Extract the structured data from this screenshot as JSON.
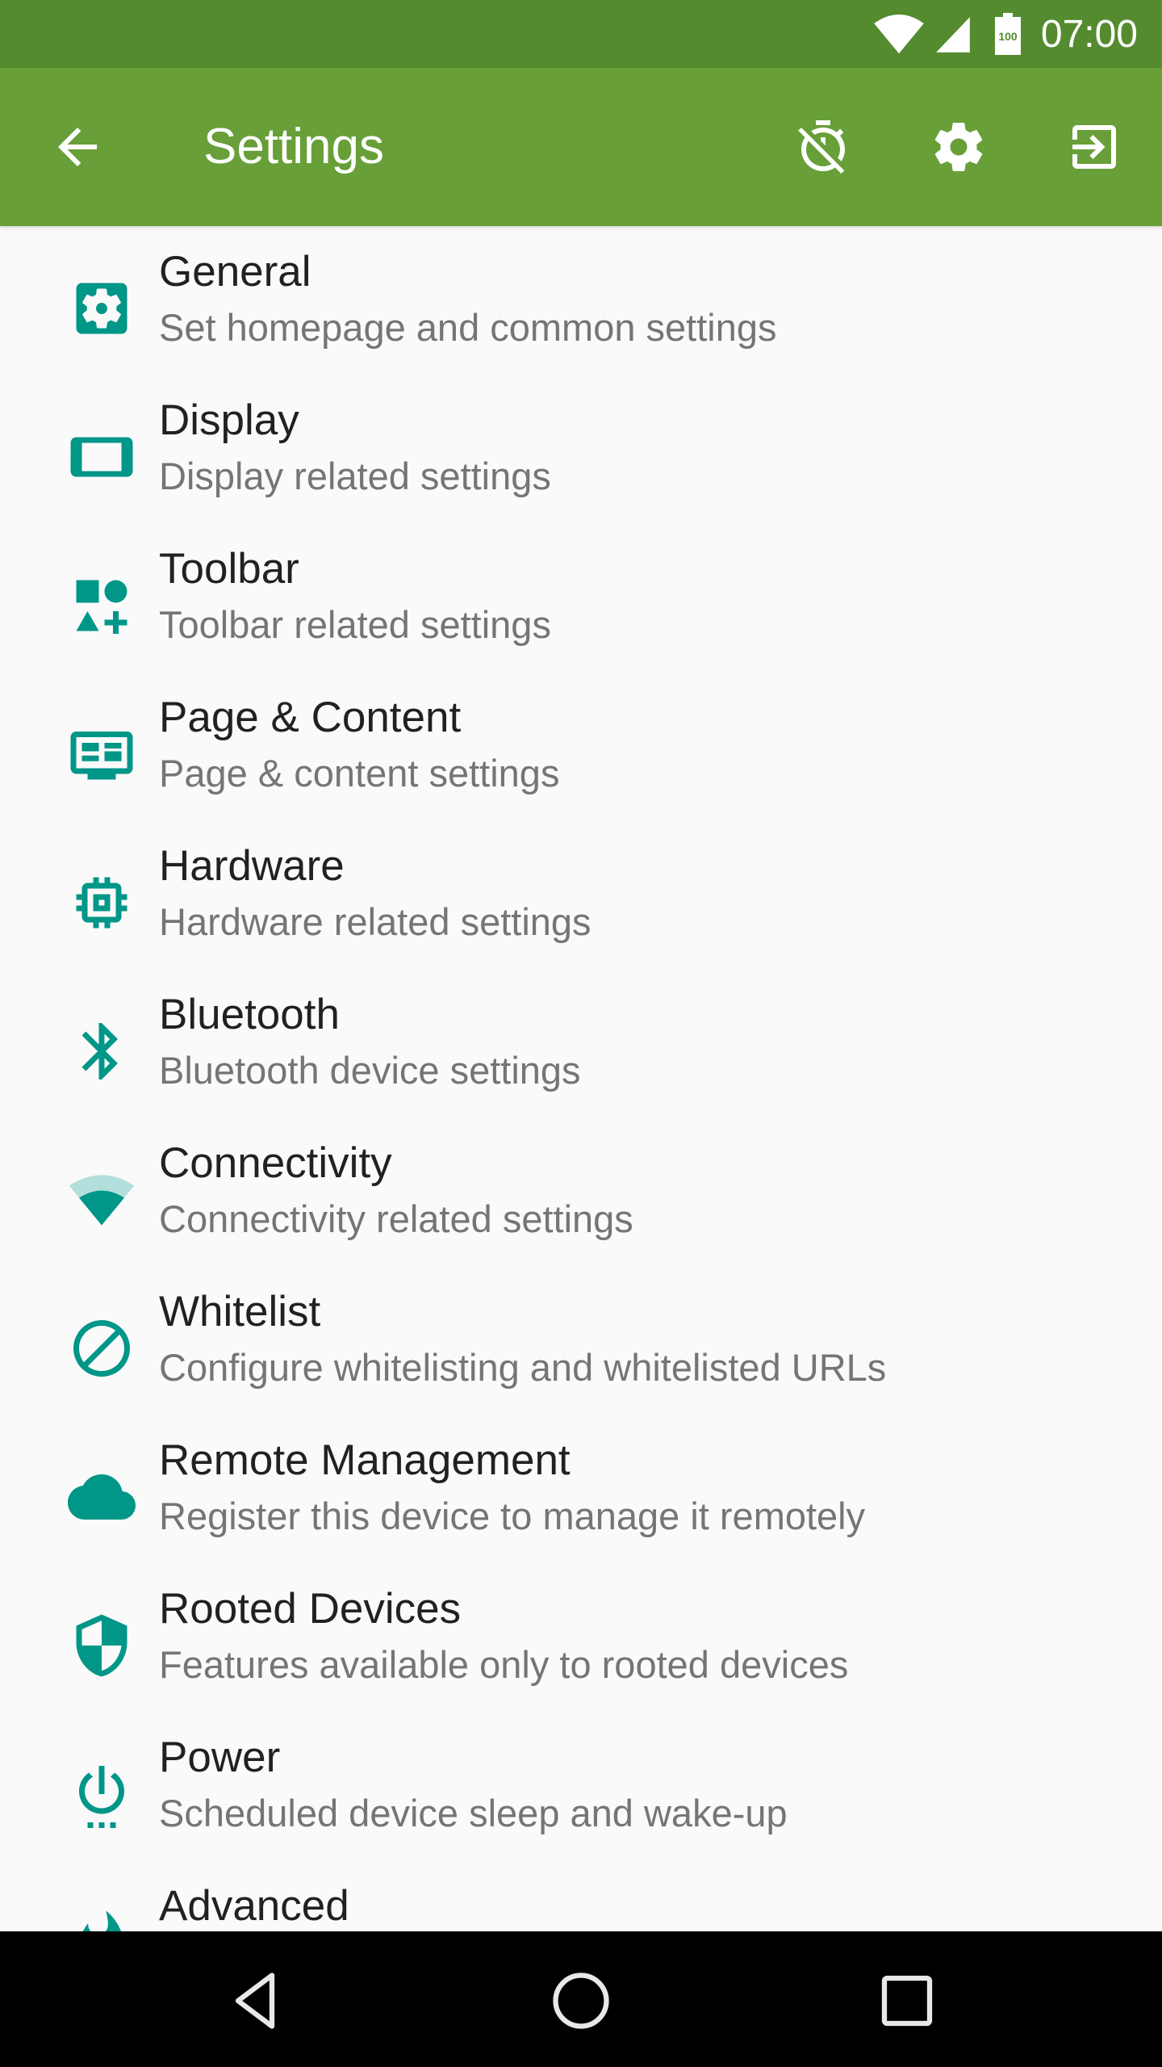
{
  "status_bar": {
    "time": "07:00",
    "battery_level": "100",
    "icons": [
      "notification-dot",
      "wifi-icon",
      "cell-signal-icon",
      "battery-icon"
    ]
  },
  "toolbar": {
    "title": "Settings",
    "back_icon": "arrow-back-icon",
    "actions": [
      {
        "name": "timer-off",
        "icon": "timer-off-icon"
      },
      {
        "name": "settings",
        "icon": "gear-icon"
      },
      {
        "name": "exit",
        "icon": "exit-to-app-icon"
      }
    ]
  },
  "colors": {
    "status_bar": "#558b2f",
    "toolbar": "#689f38",
    "icon_accent": "#009688",
    "icon_accent_light": "#b2dfdb",
    "background": "#fafafa",
    "title_text": "#212121",
    "subtitle_text": "#757575"
  },
  "settings": {
    "items": [
      {
        "title": "General",
        "subtitle": "Set homepage and common settings",
        "icon": "settings-applications-icon"
      },
      {
        "title": "Display",
        "subtitle": "Display related settings",
        "icon": "display-icon"
      },
      {
        "title": "Toolbar",
        "subtitle": "Toolbar related settings",
        "icon": "category-shapes-icon"
      },
      {
        "title": "Page & Content",
        "subtitle": "Page & content settings",
        "icon": "page-content-icon"
      },
      {
        "title": "Hardware",
        "subtitle": "Hardware related settings",
        "icon": "chip-icon"
      },
      {
        "title": "Bluetooth",
        "subtitle": "Bluetooth device settings",
        "icon": "bluetooth-icon"
      },
      {
        "title": "Connectivity",
        "subtitle": "Connectivity related settings",
        "icon": "wifi-icon"
      },
      {
        "title": "Whitelist",
        "subtitle": "Configure whitelisting and whitelisted URLs",
        "icon": "block-icon"
      },
      {
        "title": "Remote Management",
        "subtitle": "Register this device to manage it remotely",
        "icon": "cloud-icon"
      },
      {
        "title": "Rooted Devices",
        "subtitle": "Features available only to rooted devices",
        "icon": "shield-icon"
      },
      {
        "title": "Power",
        "subtitle": "Scheduled device sleep and wake-up",
        "icon": "power-settings-icon"
      },
      {
        "title": "Advanced",
        "subtitle": "",
        "icon": "flame-icon"
      }
    ]
  },
  "nav_bar": {
    "buttons": [
      "back",
      "home",
      "recents"
    ]
  }
}
